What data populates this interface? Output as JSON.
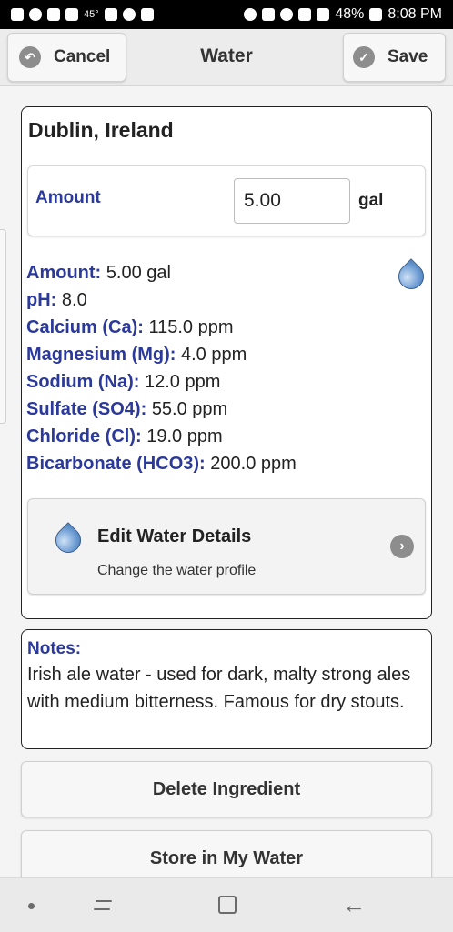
{
  "status_bar": {
    "temperature": "45°",
    "battery": "48%",
    "time": "8:08 PM"
  },
  "header": {
    "cancel_label": "Cancel",
    "title": "Water",
    "save_label": "Save"
  },
  "water": {
    "name": "Dublin, Ireland",
    "amount_label": "Amount",
    "amount_value": "5.00",
    "amount_unit": "gal",
    "properties": [
      {
        "label": "Amount:",
        "value": "5.00 gal"
      },
      {
        "label": "pH:",
        "value": "8.0"
      },
      {
        "label": "Calcium (Ca):",
        "value": "115.0 ppm"
      },
      {
        "label": "Magnesium (Mg):",
        "value": "4.0 ppm"
      },
      {
        "label": "Sodium (Na):",
        "value": "12.0 ppm"
      },
      {
        "label": "Sulfate (SO4):",
        "value": "55.0 ppm"
      },
      {
        "label": "Chloride (Cl):",
        "value": "19.0 ppm"
      },
      {
        "label": "Bicarbonate (HCO3):",
        "value": "200.0 ppm"
      }
    ],
    "edit_title": "Edit Water Details",
    "edit_subtitle": "Change the water profile"
  },
  "notes": {
    "label": "Notes:",
    "text": "Irish ale water - used for dark, malty strong ales with medium bitterness. Famous for dry stouts."
  },
  "actions": {
    "delete_label": "Delete Ingredient",
    "store_label": "Store in My Water"
  },
  "colors": {
    "label_blue": "#2b3a9a",
    "drop_blue": "#6a9ad2"
  }
}
